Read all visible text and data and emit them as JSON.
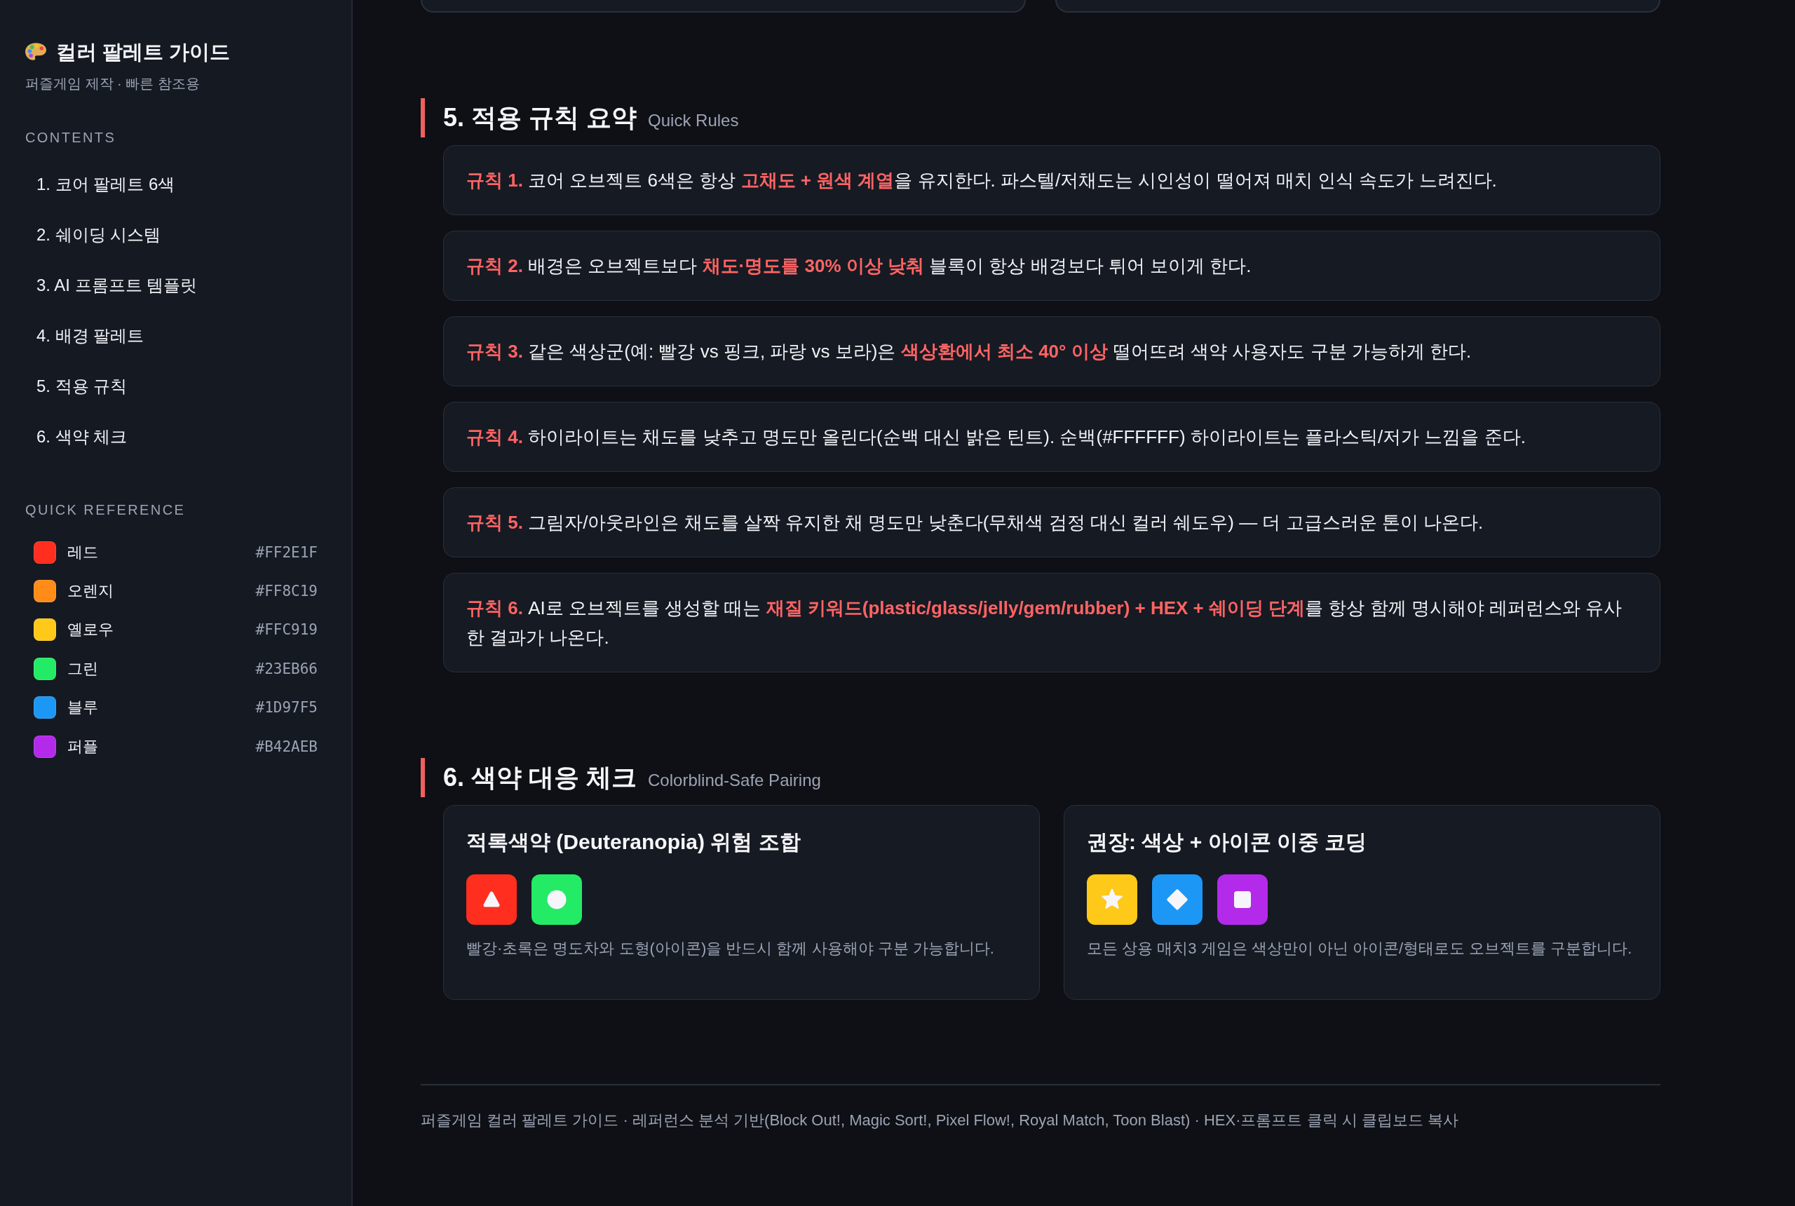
{
  "sidebar": {
    "title": "컬러 팔레트 가이드",
    "subtitle": "퍼즐게임 제작 · 빠른 참조용",
    "contents_label": "CONTENTS",
    "nav_items": [
      {
        "label": "1. 코어 팔레트 6색"
      },
      {
        "label": "2. 쉐이딩 시스템"
      },
      {
        "label": "3. AI 프롬프트 템플릿"
      },
      {
        "label": "4. 배경 팔레트"
      },
      {
        "label": "5. 적용 규칙"
      },
      {
        "label": "6. 색약 체크"
      }
    ],
    "quick_reference_label": "QUICK REFERENCE",
    "swatches": [
      {
        "name": "레드",
        "hex": "#FF2E1F",
        "color": "#ff2e1f"
      },
      {
        "name": "오렌지",
        "hex": "#FF8C19",
        "color": "#ff8c19"
      },
      {
        "name": "옐로우",
        "hex": "#FFC919",
        "color": "#ffc919"
      },
      {
        "name": "그린",
        "hex": "#23EB66",
        "color": "#23eb66"
      },
      {
        "name": "블루",
        "hex": "#1D97F5",
        "color": "#1d97f5"
      },
      {
        "name": "퍼플",
        "hex": "#B42AEB",
        "color": "#b42aeb"
      }
    ]
  },
  "main": {
    "top_cut_cards": [
      {
        "kind": "card-bottom"
      },
      {
        "kind": "card-bottom"
      }
    ],
    "rules_section": {
      "title": "5. 적용 규칙 요약",
      "subtitle": "Quick Rules",
      "rules": [
        "**규칙 1.** 코어 오브젝트 6색은 항상 **고채도 + 원색 계열**을 유지한다. 파스텔/저채도는 시인성이 떨어져 매치 인식 속도가 느려진다.",
        "**규칙 2.** 배경은 오브젝트보다 **채도·명도를 30% 이상 낮춰** 블록이 항상 배경보다 튀어 보이게 한다.",
        "**규칙 3.** 같은 색상군(예: 빨강 vs 핑크, 파랑 vs 보라)은 **색상환에서 최소 40° 이상** 떨어뜨려 색약 사용자도 구분 가능하게 한다.",
        "**규칙 4.** 하이라이트는 채도를 낮추고 명도만 올린다(순백 대신 밝은 틴트). 순백(#FFFFFF) 하이라이트는 플라스틱/저가 느낌을 준다.",
        "**규칙 5.** 그림자/아웃라인은 채도를 살짝 유지한 채 명도만 낮춘다(무채색 검정 대신 컬러 쉐도우) — 더 고급스러운 톤이 나온다.",
        "**규칙 6.** AI로 오브젝트를 생성할 때는 **재질 키워드(plastic/glass/jelly/gem/rubber) + HEX + 쉐이딩 단계**를 항상 함께 명시해야 레퍼런스와 유사한 결과가 나온다."
      ]
    },
    "colorblind_section": {
      "title": "6. 색약 대응 체크",
      "subtitle": "Colorblind-Safe Pairing",
      "cards": [
        {
          "title": "적록색약 (Deuteranopia) 위험 조합",
          "tiles": [
            {
              "kind": "triangle",
              "color": "#ff2e1f"
            },
            {
              "kind": "circle",
              "color": "#23eb66"
            }
          ],
          "caption": "빨강·초록은 명도차와 도형(아이콘)을 반드시 함께 사용해야 구분 가능합니다."
        },
        {
          "title": "권장: 색상 + 아이콘 이중 코딩",
          "tiles": [
            {
              "kind": "star",
              "color": "#ffc919"
            },
            {
              "kind": "diamond",
              "color": "#1d97f5"
            },
            {
              "kind": "square",
              "color": "#b42aeb"
            }
          ],
          "caption": "모든 상용 매치3 게임은 색상만이 아닌 아이콘/형태로도 오브젝트를 구분합니다."
        }
      ]
    },
    "footer": "퍼즐게임 컬러 팔레트 가이드 · 레퍼런스 분석 기반(Block Out!, Magic Sort!, Pixel Flow!, Royal Match, Toon Blast) · HEX·프롬프트 클릭 시 클립보드 복사"
  }
}
